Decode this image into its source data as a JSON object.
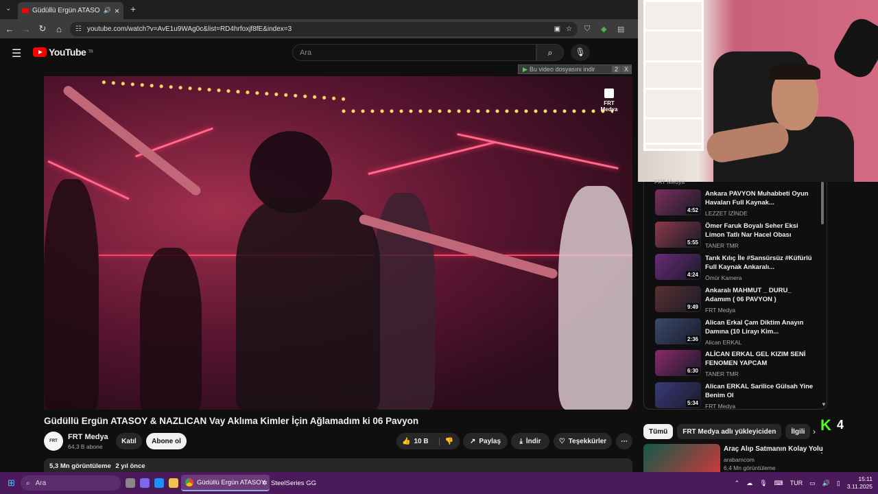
{
  "browser": {
    "tab_title": "Güdüllü Ergün ATASOY & N",
    "url": "youtube.com/watch?v=AvE1u9WAg0c&list=RD4hrfoxjf8fE&index=3",
    "new_tab": "+",
    "tab_close": "×",
    "tab_menu": "⌄"
  },
  "youtube": {
    "logo_text": "YouTube",
    "logo_region": "TR",
    "search_placeholder": "Ara",
    "download_bar": "Bu video dosyasını indir",
    "download_bar_extra": "2",
    "download_bar_close": "X"
  },
  "video": {
    "watermark_line1": "FRT",
    "watermark_line2": "Medya",
    "title": "Güdüllü Ergün ATASOY & NAZLICAN Vay Aklıma Kimler İçin Ağlamadım ki 06 Pavyon",
    "channel_name": "FRT Medya",
    "channel_avatar": "FRT",
    "subscribers": "64,3 B abone",
    "join_label": "Katıl",
    "subscribe_label": "Abone ol",
    "like_count": "10 B",
    "share_label": "Paylaş",
    "download_label": "İndir",
    "thanks_label": "Teşekkürler",
    "more_label": "⋯",
    "views": "5,3 Mn görüntüleme",
    "age": "2 yıl önce"
  },
  "playlist": {
    "cut_channel": "FRT Medya",
    "items": [
      {
        "title": "Ankara PAVYON Muhabbeti Oyun Havaları Full Kaynak...",
        "channel": "LEZZET İZİNDE",
        "duration": "4:52",
        "color": "#7a2f5a"
      },
      {
        "title": "Ömer Faruk Boyalı Seher Eksi Limon Tatlı Nar Hacel Obası",
        "channel": "TANER TMR",
        "duration": "5:55",
        "color": "#8a3a48"
      },
      {
        "title": "Tarık Kılıç İle #Sansürsüz #Küfürlü Full Kaynak Ankaralı...",
        "channel": "Ömür Kamera",
        "duration": "4:24",
        "color": "#6a2a7a"
      },
      {
        "title": "Ankaralı MAHMUT _ DURU_ Adamım ( 06 PAVYON )",
        "channel": "FRT Medya",
        "duration": "9:49",
        "color": "#5a3030"
      },
      {
        "title": "Alican Erkal Çam Diktim Anayın Damına (10 Lirayı Kim...",
        "channel": "Alican ERKAL",
        "duration": "2:36",
        "color": "#3a4a6a"
      },
      {
        "title": "ALİCAN ERKAL GEL KIZIM SENİ FENOMEN YAPCAM",
        "channel": "TANER TMR",
        "duration": "6:30",
        "color": "#8a2a6a"
      },
      {
        "title": "Alican ERKAL Sarilice Gülsah Yine Benim Ol",
        "channel": "FRT Medya",
        "duration": "5:34",
        "color": "#3a3a7a"
      }
    ]
  },
  "chips": [
    "Tümü",
    "FRT Medya adlı yükleyiciden",
    "İlgili"
  ],
  "overlay": {
    "badge": "4"
  },
  "recommendation": {
    "title": "Araç Alıp Satmanın Kolay Yolu",
    "channel": "arabamcom",
    "views": "6,4 Mn görüntüleme"
  },
  "taskbar": {
    "search_placeholder": "Ara",
    "app1": "Güdüllü Ergün ATASOY",
    "app2": "SteelSeries GG",
    "lang": "TUR",
    "time": "15:11",
    "date": "3.11.2025"
  }
}
